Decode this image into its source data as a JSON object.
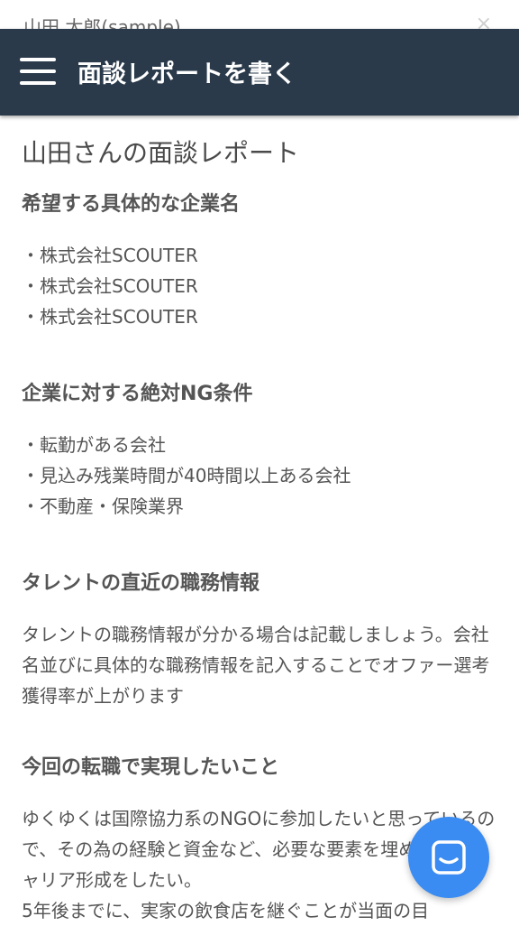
{
  "behind_modal": {
    "candidate_name": "山田 太郎(sample)",
    "close_glyph": "×"
  },
  "header": {
    "title": "面談レポートを書く",
    "menu_icon": "hamburger-icon"
  },
  "report": {
    "title": "山田さんの面談レポート",
    "sections": {
      "companies": {
        "heading": "希望する具体的な企業名",
        "items": [
          "・株式会社SCOUTER",
          "・株式会社SCOUTER",
          "・株式会社SCOUTER"
        ]
      },
      "ng": {
        "heading": "企業に対する絶対NG条件",
        "items": [
          "・転勤がある会社",
          "・見込み残業時間が40時間以上ある会社",
          "・不動産・保険業界"
        ]
      },
      "recent_job": {
        "heading": "タレントの直近の職務情報",
        "text": "タレントの職務情報が分かる場合は記載しましょう。会社名並びに具体的な職務情報を記入することでオファー選考獲得率が上がります"
      },
      "goals": {
        "heading": "今回の転職で実現したいこと",
        "text": "ゆくゆくは国際協力系のNGOに参加したいと思っているので、その為の経験と資金など、必要な要素を埋める為のキャリア形成をしたい。\n5年後までに、実家の飲食店を継ぐことが当面の目"
      }
    }
  },
  "chat_button": {
    "icon": "chat-icon",
    "color": "#3a8bf2"
  },
  "colors": {
    "header_bg": "#2a3a4b",
    "text": "#555555"
  }
}
